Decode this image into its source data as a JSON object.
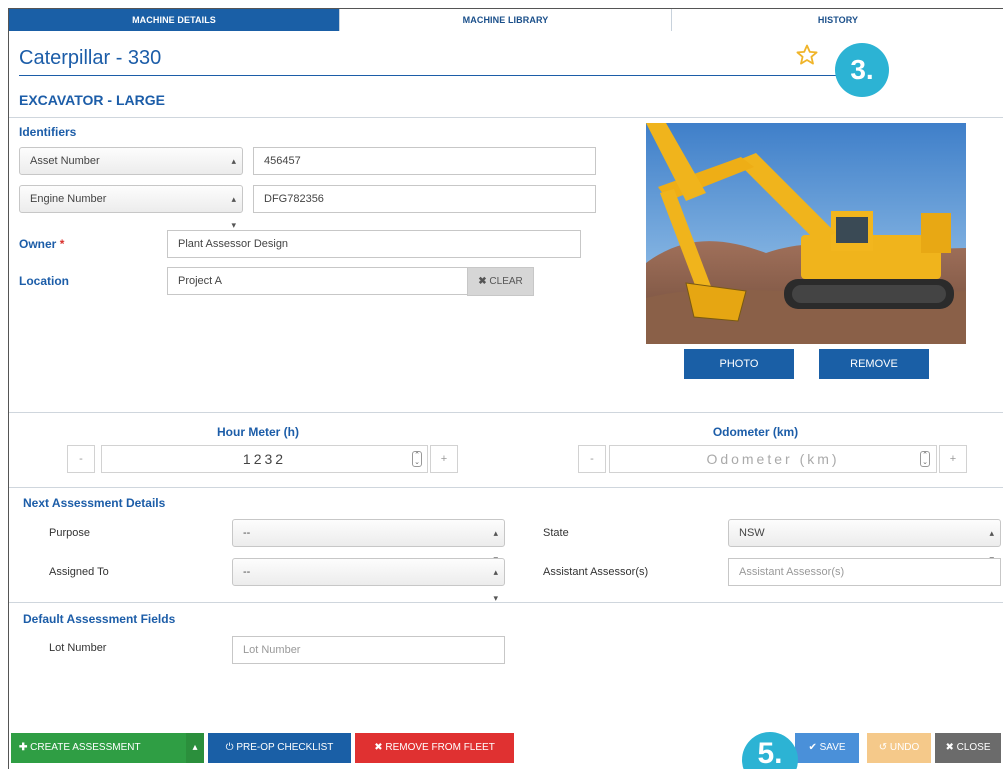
{
  "tabs": [
    {
      "label": "MACHINE DETAILS",
      "active": true
    },
    {
      "label": "MACHINE LIBRARY",
      "active": false
    },
    {
      "label": "HISTORY",
      "active": false
    }
  ],
  "header": {
    "title": "Caterpillar - 330",
    "subtitle": "EXCAVATOR - LARGE",
    "star_icon": "star-outline-icon",
    "callout_top": "3.",
    "callout_bottom": "5."
  },
  "identifiers": {
    "label": "Identifiers",
    "rows": [
      {
        "type": "Asset Number",
        "value": "456457"
      },
      {
        "type": "Engine Number",
        "value": "DFG782356"
      }
    ]
  },
  "owner": {
    "label": "Owner",
    "required_mark": "*",
    "value": "Plant Assessor Design"
  },
  "location": {
    "label": "Location",
    "value": "Project A",
    "clear_label": "CLEAR"
  },
  "photo": {
    "photo_label": "PHOTO",
    "remove_label": "REMOVE"
  },
  "hour_meter": {
    "label": "Hour Meter (h)",
    "value": "1232",
    "minus": "-",
    "plus": "+"
  },
  "odometer": {
    "label": "Odometer (km)",
    "placeholder": "Odometer (km)",
    "minus": "-",
    "plus": "+"
  },
  "next_assessment": {
    "label": "Next Assessment Details",
    "purpose_label": "Purpose",
    "purpose_value": "--",
    "assigned_label": "Assigned To",
    "assigned_value": "--",
    "state_label": "State",
    "state_value": "NSW",
    "assistant_label": "Assistant Assessor(s)",
    "assistant_placeholder": "Assistant Assessor(s)"
  },
  "default_fields": {
    "label": "Default Assessment Fields",
    "lot_label": "Lot Number",
    "lot_placeholder": "Lot Number"
  },
  "footer": {
    "create_assessment": "CREATE ASSESSMENT",
    "preop_checklist": "PRE-OP CHECKLIST",
    "remove_fleet": "REMOVE FROM FLEET",
    "save": "SAVE",
    "undo": "UNDO",
    "close": "CLOSE"
  },
  "colors": {
    "primary": "#1a5fa6",
    "accent": "#2cb3d4",
    "success": "#2f9e44",
    "danger": "#e03131",
    "undo": "#f5c98a",
    "close": "#6b6b6b"
  }
}
